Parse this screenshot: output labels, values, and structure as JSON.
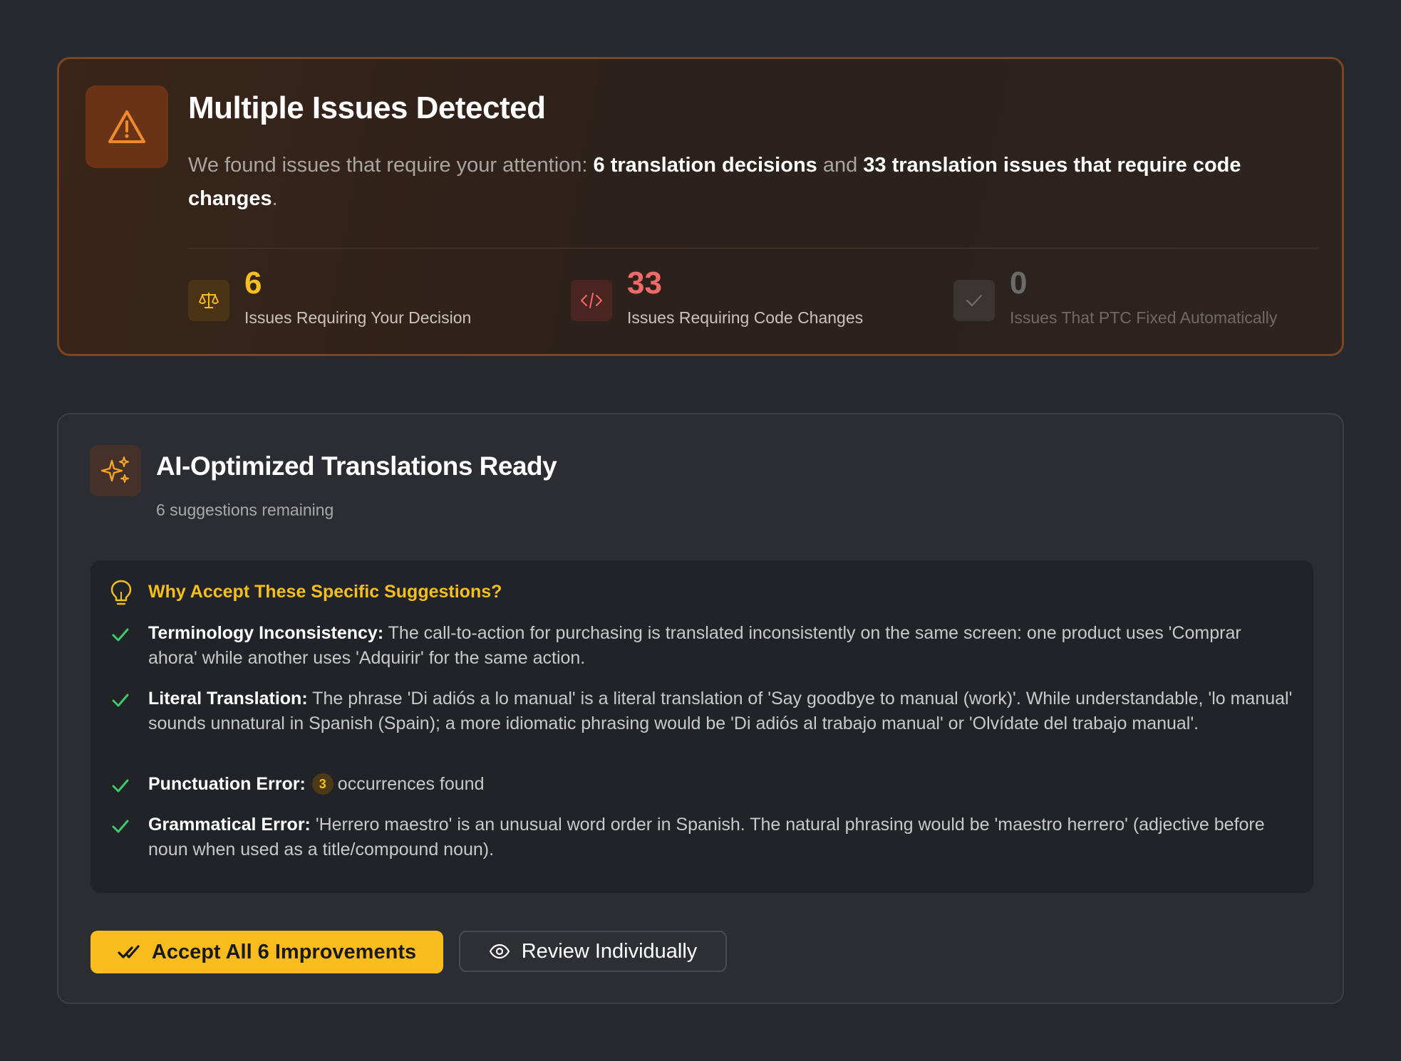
{
  "issues": {
    "title": "Multiple Issues Detected",
    "desc_prefix": "We found issues that require your attention: ",
    "desc_bold1": "6 translation decisions",
    "desc_mid": " and ",
    "desc_bold2": "33 translation issues that require code changes",
    "desc_suffix": ".",
    "stats": [
      {
        "value": "6",
        "label": "Issues Requiring Your Decision",
        "color": "#f5bf1f",
        "icon": "scale-icon"
      },
      {
        "value": "33",
        "label": "Issues Requiring Code Changes",
        "color": "#f06a6a",
        "icon": "code-icon"
      },
      {
        "value": "0",
        "label": "Issues That PTC Fixed Automatically",
        "color": "#6a6a6a",
        "icon": "check-icon"
      }
    ]
  },
  "ai": {
    "title": "AI-Optimized Translations Ready",
    "subtitle": "6 suggestions remaining",
    "why_title": "Why Accept These Specific Suggestions?",
    "reasons": [
      {
        "label": "Terminology Inconsistency:",
        "text": "The call-to-action for purchasing is translated inconsistently on the same screen: one product uses 'Comprar ahora' while another uses 'Adquirir' for the same action."
      },
      {
        "label": "Literal Translation:",
        "text": "The phrase 'Di adiós a lo manual' is a literal translation of 'Say goodbye to manual (work)'. While understandable, 'lo manual' sounds unnatural in Spanish (Spain); a more idiomatic phrasing would be 'Di adiós al trabajo manual' or 'Olvídate del trabajo manual'."
      },
      {
        "label": "Punctuation Error:",
        "count": "3",
        "text": "occurrences found"
      },
      {
        "label": "Grammatical Error:",
        "text": "'Herrero maestro' is an unusual word order in Spanish. The natural phrasing would be 'maestro herrero' (adjective before noun when used as a title/compound noun)."
      }
    ],
    "accept_label": "Accept All 6 Improvements",
    "review_label": "Review Individually"
  },
  "colors": {
    "accent_yellow": "#fbbd1e",
    "danger_red": "#f06a6a",
    "success_green": "#3ec96b",
    "warning_orange": "#f08a2e"
  }
}
